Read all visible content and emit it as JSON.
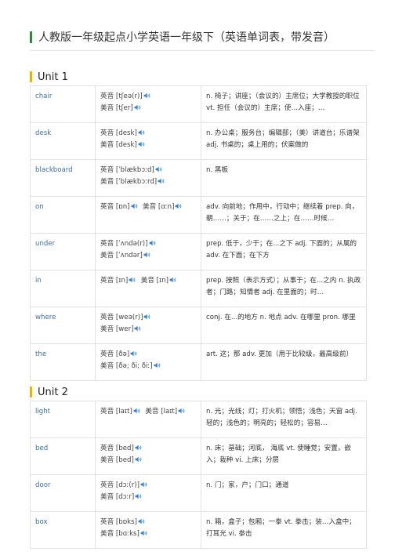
{
  "page_title": "人教版一年级起点小学英语一年级下（英语单词表，带发音）",
  "units": [
    {
      "heading": "Unit 1",
      "rows": [
        {
          "word": "chair",
          "pron": [
            "英音 [tʃeə(r)]",
            "美音 [tʃer]"
          ],
          "meaning": "n. 椅子；讲座；（会议的）主席位；大学教授的职位 vt. 担任（会议的）主席；使…入座；…"
        },
        {
          "word": "desk",
          "pron": [
            "英音 [desk]",
            "美音 [desk]"
          ],
          "meaning": "n. 办公桌；服务台；编辑部；（美）讲道台；乐谱架 adj. 书桌的；桌上用的；伏案做的"
        },
        {
          "word": "blackboard",
          "pron": [
            "英音 [ˈblækbɔːd]",
            "美音 [ˈblækbɔːrd]"
          ],
          "meaning": "n. 黑板"
        },
        {
          "word": "on",
          "pron": [
            "英音 [ɒn]  美音 [ɑːn]"
          ],
          "meaning": "adv. 向前地；作用中，行动中；继续着 prep. 向，朝……；关于；在……之上；在……时候…"
        },
        {
          "word": "under",
          "pron": [
            "英音 [ˈʌndə(r)]",
            "美音 [ˈʌndər]"
          ],
          "meaning": "prep. 低于，少于；在...之下 adj. 下面的；从属的 adv. 在下面；在下方"
        },
        {
          "word": "in",
          "pron": [
            "英音 [ɪn]  美音 [ɪn]"
          ],
          "meaning": "prep. 按照（表示方式）；从事于；在...之内 n. 执政者；门路；知情者 adj. 在里面的；时…"
        },
        {
          "word": "where",
          "pron": [
            "英音 [weə(r)]",
            "美音 [wer]"
          ],
          "meaning": "conj. 在...的地方 n. 地点 adv. 在哪里 pron. 哪里"
        },
        {
          "word": "the",
          "pron": [
            "英音 [ðə]",
            "美音 [ðə; ði; ðiː]"
          ],
          "meaning": "art. 这；那 adv. 更加（用于比较级，最高级前）"
        }
      ]
    },
    {
      "heading": "Unit 2",
      "rows": [
        {
          "word": "light",
          "pron": [
            "英音 [laɪt]  美音 [laɪt]"
          ],
          "meaning": "n. 光；光线；灯；打火机；领悟；浅色；天窗 adj. 轻的；浅色的；明亮的；轻松的；容易…"
        },
        {
          "word": "bed",
          "pron": [
            "英音 [bed]",
            "美音 [bed]"
          ],
          "meaning": "n. 床；基础；河底， 海底 vt. 使睡觉；安置，嵌入；栽种 vi. 上床；分层"
        },
        {
          "word": "door",
          "pron": [
            "英音 [dɔː(r)]",
            "美音 [dɔːr]"
          ],
          "meaning": "n. 门；家，户；门口；通道"
        },
        {
          "word": "box",
          "pron": [
            "英音 [bɒks]",
            "美音 [bɑːks]"
          ],
          "meaning": "n. 箱，盒子；包厢；一拳 vt. 拳击；装…入盒中；打耳光 vi. 拳击"
        }
      ]
    }
  ],
  "colors": {
    "accent_green": "#2e8b3a",
    "accent_yellow": "#f0b400",
    "word_blue": "#3a6fb0",
    "speaker_blue": "#2f7fd6"
  }
}
